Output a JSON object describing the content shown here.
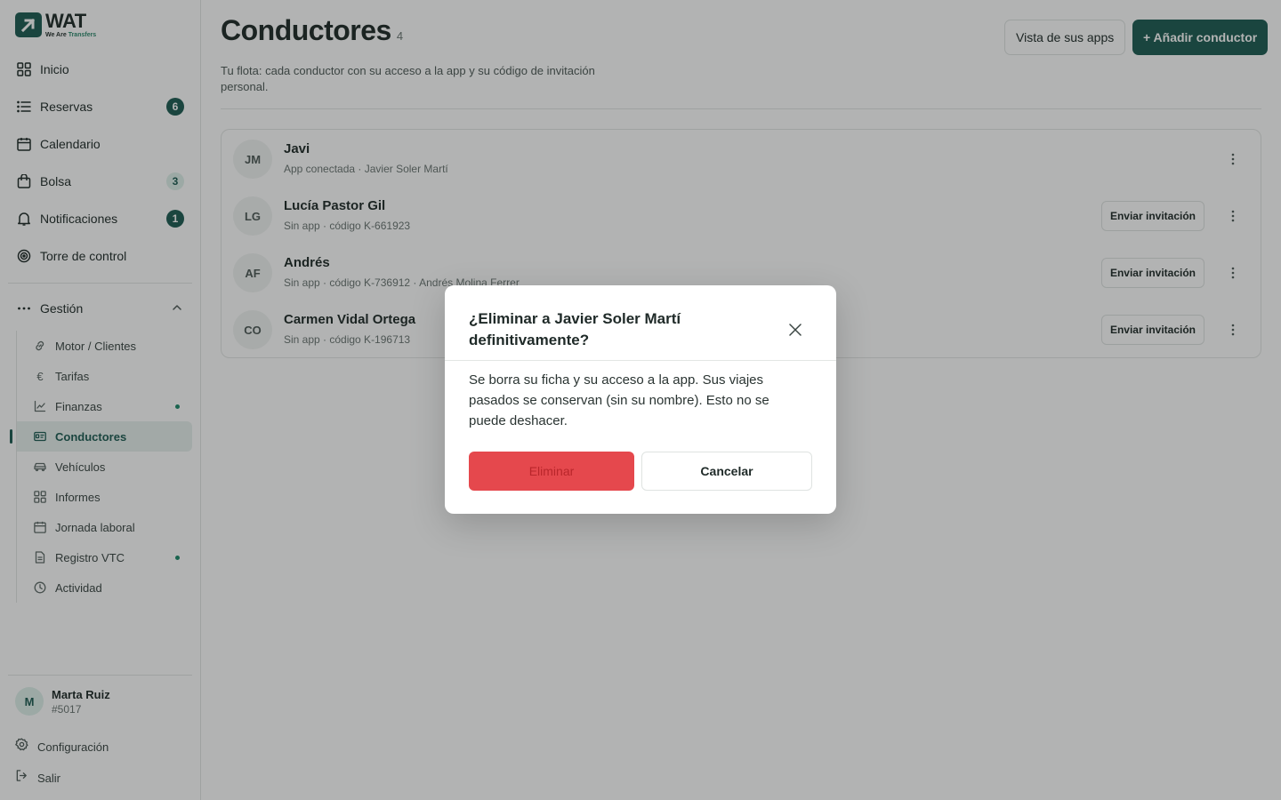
{
  "brand": {
    "name": "WAT",
    "tagline_a": "We Are ",
    "tagline_b": "Transfers",
    "color": "#1d5c52"
  },
  "sidebar": {
    "items": [
      {
        "label": "Inicio",
        "icon": "grid-icon"
      },
      {
        "label": "Reservas",
        "icon": "list-icon",
        "badge": "6"
      },
      {
        "label": "Calendario",
        "icon": "calendar-icon"
      },
      {
        "label": "Bolsa",
        "icon": "bag-icon",
        "badge": "3"
      },
      {
        "label": "Notificaciones",
        "icon": "bell-icon",
        "badge": "1"
      },
      {
        "label": "Torre de control",
        "icon": "target-icon"
      }
    ],
    "group": {
      "label": "Gestión",
      "icon": "more-icon"
    },
    "subitems": [
      {
        "label": "Motor / Clientes",
        "icon": "link-icon"
      },
      {
        "label": "Tarifas",
        "icon": "euro-icon"
      },
      {
        "label": "Finanzas",
        "icon": "chart-icon",
        "dot": true
      },
      {
        "label": "Conductores",
        "icon": "id-card-icon",
        "active": true
      },
      {
        "label": "Vehículos",
        "icon": "car-icon"
      },
      {
        "label": "Informes",
        "icon": "grid-icon"
      },
      {
        "label": "Jornada laboral",
        "icon": "calendar-icon"
      },
      {
        "label": "Registro VTC",
        "icon": "document-icon",
        "dot": true
      },
      {
        "label": "Actividad",
        "icon": "clock-icon"
      }
    ],
    "user": {
      "initial": "M",
      "name": "Marta Ruiz",
      "id": "#5017"
    },
    "settings_label": "Configuración",
    "logout_label": "Salir"
  },
  "header": {
    "title": "Conductores",
    "count": "4",
    "subtitle": "Tu flota: cada conductor con su acceso a la app y su código de invitación personal.",
    "apps_button": "Vista de sus apps",
    "add_button": "+ Añadir conductor"
  },
  "drivers": [
    {
      "initials": "JM",
      "name": "Javi",
      "meta": "App conectada · Javier Soler Martí",
      "invite": ""
    },
    {
      "initials": "LG",
      "name": "Lucía Pastor Gil",
      "meta": "Sin app · código K-661923",
      "invite": "Enviar invitación"
    },
    {
      "initials": "AF",
      "name": "Andrés",
      "meta": "Sin app · código K-736912 · Andrés Molina Ferrer",
      "invite": "Enviar invitación"
    },
    {
      "initials": "CO",
      "name": "Carmen Vidal Ortega",
      "meta": "Sin app · código K-196713",
      "invite": "Enviar invitación"
    }
  ],
  "modal": {
    "title": "¿Eliminar a Javier Soler Martí definitivamente?",
    "body": "Se borra su ficha y su acceso a la app. Sus viajes pasados se conservan (sin su nombre). Esto no se puede deshacer.",
    "confirm_label": "Eliminar",
    "cancel_label": "Cancelar",
    "danger_color": "#e5484d"
  }
}
